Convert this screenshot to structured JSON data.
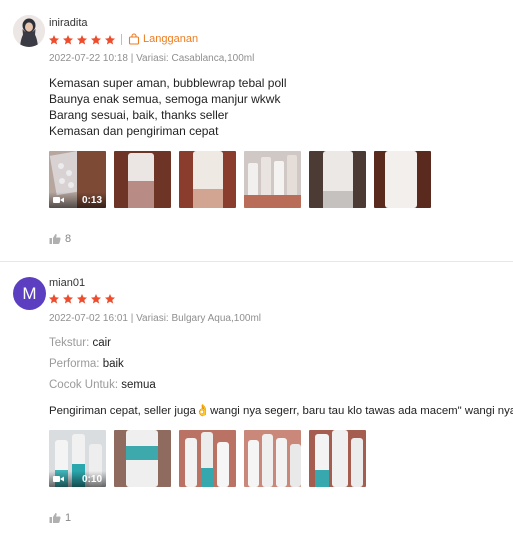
{
  "reviews": [
    {
      "username": "iniradita",
      "rating": 5,
      "badge": "Langganan",
      "meta": "2022-07-22 10:18 | Variasi: Casablanca,100ml",
      "comment_lines": [
        "Kemasan super aman, bubblewrap tebal poll",
        "Baunya enak semua, semoga manjur wkwk",
        "Barang sesuai, baik, thanks seller",
        "Kemasan dan pengiriman cepat"
      ],
      "video_duration": "0:13",
      "likes": "8"
    },
    {
      "avatar_letter": "M",
      "username": "mian01",
      "rating": 5,
      "meta": "2022-07-02 16:01 | Variasi: Bulgary Aqua,100ml",
      "attributes": [
        {
          "key": "Tekstur:",
          "value": "cair"
        },
        {
          "key": "Performa:",
          "value": "baik"
        },
        {
          "key": "Cocok Untuk:",
          "value": "semua"
        }
      ],
      "comment_lines": [
        "Pengiriman cepat, seller juga👌wangi nya segerr, baru tau klo tawas ada macem\" wangi nya"
      ],
      "video_duration": "0:10",
      "likes": "1"
    }
  ],
  "colors": {
    "star": "#ee4d2d",
    "badge": "#ee7d21",
    "avatar_m": "#5b3fc0"
  },
  "icons": {
    "star": "star-icon",
    "badge": "bag-icon",
    "video": "video-camera-icon",
    "like": "thumbs-up-icon"
  }
}
